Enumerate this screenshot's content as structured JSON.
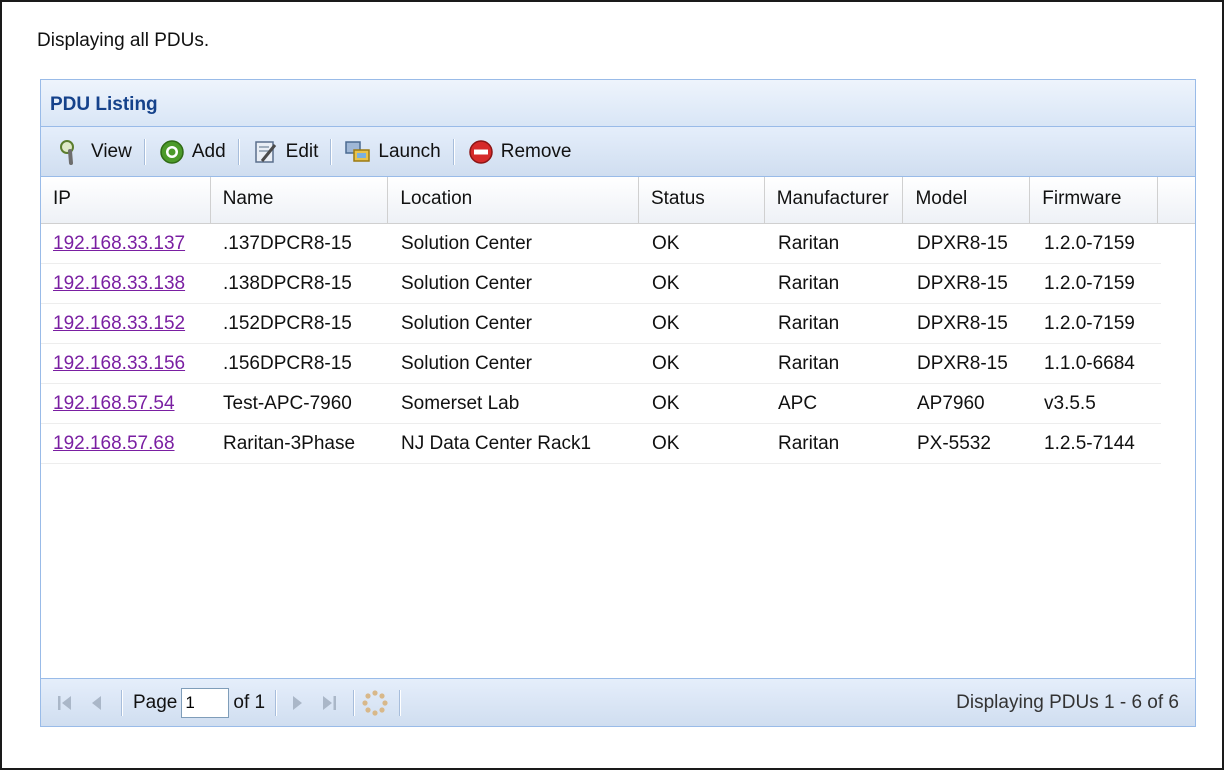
{
  "intro": "Displaying all PDUs.",
  "panel": {
    "title": "PDU Listing"
  },
  "toolbar": {
    "view": "View",
    "add": "Add",
    "edit": "Edit",
    "launch": "Launch",
    "remove": "Remove"
  },
  "columns": [
    "IP",
    "Name",
    "Location",
    "Status",
    "Manufacturer",
    "Model",
    "Firmware"
  ],
  "rows": [
    [
      "192.168.33.137",
      ".137DPCR8-15",
      "Solution Center",
      "OK",
      "Raritan",
      "DPXR8-15",
      "1.2.0-7159"
    ],
    [
      "192.168.33.138",
      ".138DPCR8-15",
      "Solution Center",
      "OK",
      "Raritan",
      "DPXR8-15",
      "1.2.0-7159"
    ],
    [
      "192.168.33.152",
      ".152DPCR8-15",
      "Solution Center",
      "OK",
      "Raritan",
      "DPXR8-15",
      "1.2.0-7159"
    ],
    [
      "192.168.33.156",
      ".156DPCR8-15",
      "Solution Center",
      "OK",
      "Raritan",
      "DPXR8-15",
      "1.1.0-6684"
    ],
    [
      "192.168.57.54",
      "Test-APC-7960",
      "Somerset Lab",
      "OK",
      "APC",
      "AP7960",
      "v3.5.5"
    ],
    [
      "192.168.57.68",
      "Raritan-3Phase",
      "NJ Data Center Rack1",
      "OK",
      "Raritan",
      "PX-5532",
      "1.2.5-7144"
    ]
  ],
  "pager": {
    "page_label": "Page",
    "page_value": "1",
    "of_label": "of 1",
    "status": "Displaying PDUs 1 - 6 of 6"
  },
  "icons": {
    "view": "magnifier-icon",
    "add": "add-circle-icon",
    "edit": "edit-icon",
    "launch": "launch-icon",
    "remove": "remove-circle-icon",
    "refresh": "refresh-icon"
  },
  "colors": {
    "header_text": "#15428b",
    "link": "#7a1fa2",
    "border": "#99bbe8"
  }
}
